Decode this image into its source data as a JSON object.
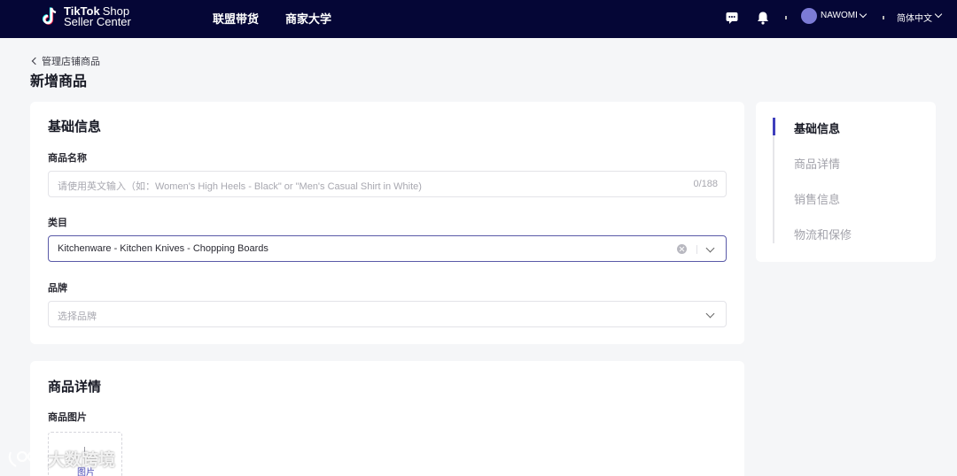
{
  "topbar": {
    "logo_brand": "TikTok",
    "logo_shop": "Shop",
    "logo_sub": "Seller Center",
    "nav": [
      "联盟带货",
      "商家大学"
    ],
    "user_name": "NAWOMI",
    "language": "简体中文"
  },
  "header": {
    "back_label": "管理店铺商品",
    "page_title": "新增商品"
  },
  "basic_info": {
    "title": "基础信息",
    "name_label": "商品名称",
    "name_placeholder": "请使用英文输入（如：Women's High Heels - Black\" or \"Men's Casual Shirt in White)",
    "name_count": "0/188",
    "category_label": "类目",
    "category_value": "Kitchenware - Kitchen Knives - Chopping Boards",
    "brand_label": "品牌",
    "brand_placeholder": "选择品牌"
  },
  "product_details": {
    "title": "商品详情",
    "images_label": "商品图片",
    "image_upload_label": "图片"
  },
  "sidenav": {
    "items": [
      "基础信息",
      "商品详情",
      "销售信息",
      "物流和保修"
    ],
    "active_index": 0
  },
  "watermark": {
    "text": "大数跨境"
  },
  "colors": {
    "topbar": "#050636",
    "accent": "#3f3fbc"
  },
  "icons": [
    "tiktok-logo-icon",
    "message-icon",
    "bell-icon",
    "avatar",
    "chevron-down-icon",
    "back-chevron-icon",
    "clear-icon"
  ]
}
